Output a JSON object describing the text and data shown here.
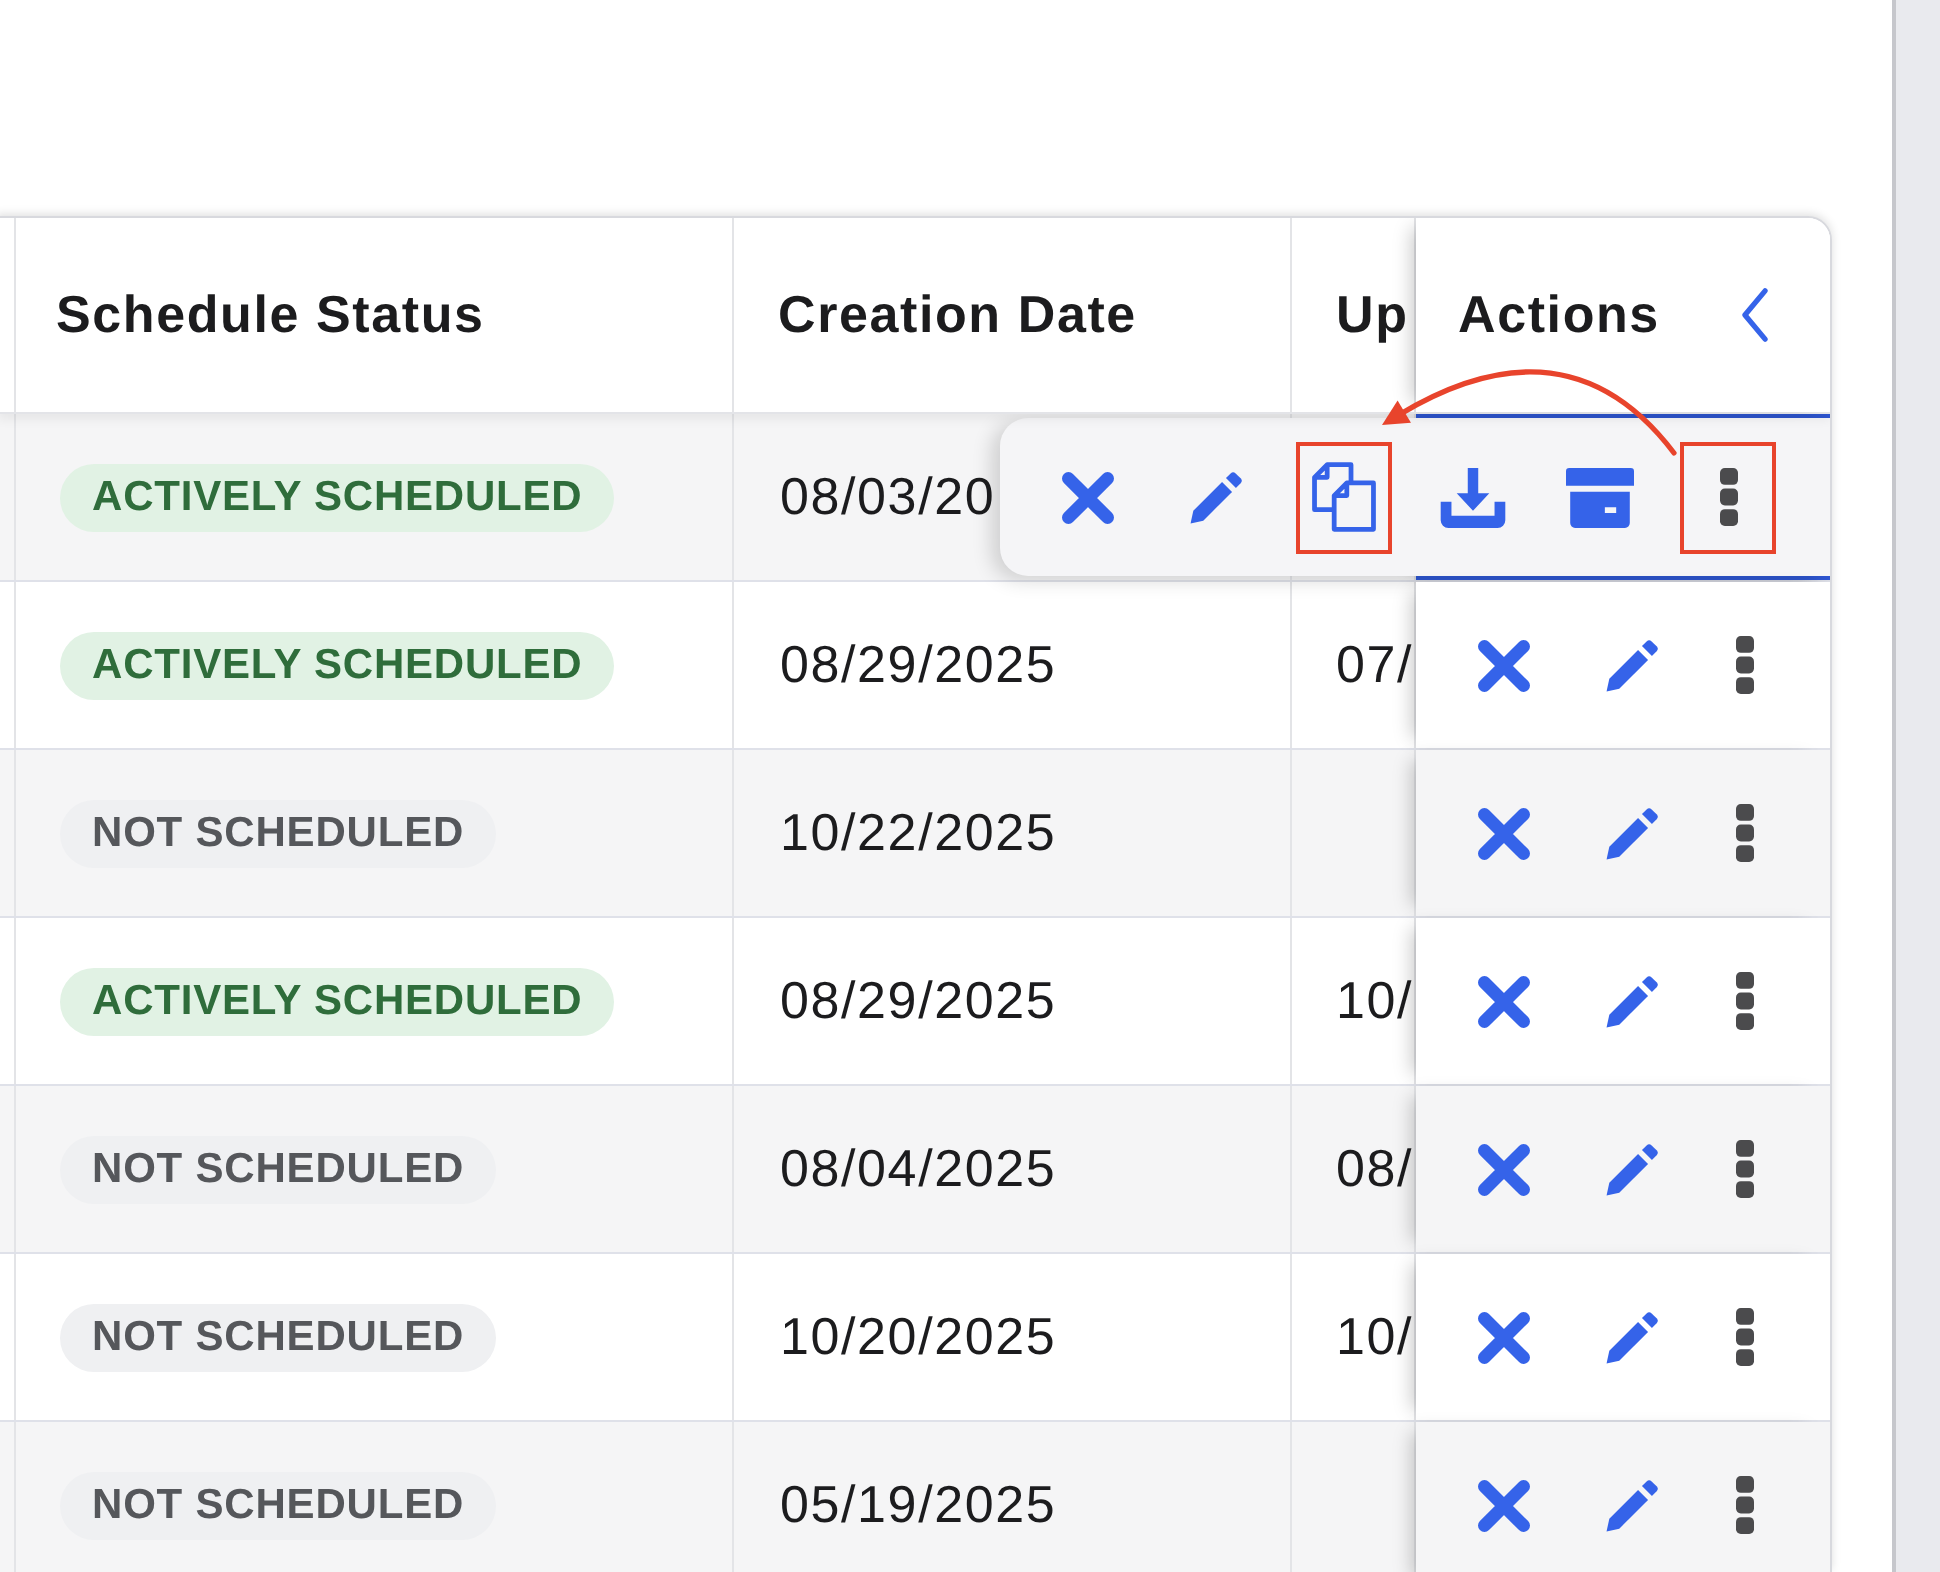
{
  "table": {
    "columns": [
      {
        "label": "Schedule Status"
      },
      {
        "label": "Creation Date"
      },
      {
        "label": "Up"
      },
      {
        "label": "Actions"
      }
    ],
    "rows": [
      {
        "schedule_status": {
          "label": "ACTIVELY SCHEDULED",
          "kind": "active"
        },
        "creation_date": "08/03/20",
        "actions_open": true
      },
      {
        "schedule_status": {
          "label": "ACTIVELY SCHEDULED",
          "kind": "active"
        },
        "creation_date": "08/29/2025",
        "column_3": "07/",
        "actions_open": false
      },
      {
        "schedule_status": {
          "label": "NOT SCHEDULED",
          "kind": "inactive"
        },
        "creation_date": "10/22/2025",
        "actions_open": false
      },
      {
        "schedule_status": {
          "label": "ACTIVELY SCHEDULED",
          "kind": "active"
        },
        "creation_date": "08/29/2025",
        "column_3": "10/",
        "actions_open": false
      },
      {
        "schedule_status": {
          "label": "NOT SCHEDULED",
          "kind": "inactive"
        },
        "creation_date": "08/04/2025",
        "column_3": "08/",
        "actions_open": false
      },
      {
        "schedule_status": {
          "label": "NOT SCHEDULED",
          "kind": "inactive"
        },
        "creation_date": "10/20/2025",
        "column_3": "10/",
        "actions_open": false
      },
      {
        "schedule_status": {
          "label": "NOT SCHEDULED",
          "kind": "inactive"
        },
        "creation_date": "05/19/2025",
        "actions_open": false
      }
    ],
    "action_toolbar": {
      "annotation_arrow": true,
      "items": [
        {
          "kind": "cross",
          "highlighted": false
        },
        {
          "kind": "pencil",
          "highlighted": false
        },
        {
          "kind": "copy",
          "highlighted": true
        },
        {
          "kind": "download",
          "highlighted": false
        },
        {
          "kind": "archive",
          "highlighted": false
        },
        {
          "kind": "kebab",
          "highlighted": true
        }
      ]
    }
  }
}
